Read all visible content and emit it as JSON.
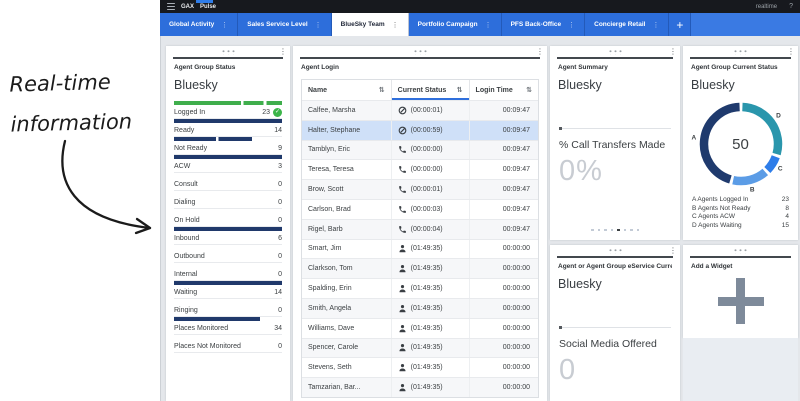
{
  "annotation": {
    "line1": "Real-time",
    "line2": "information"
  },
  "topbar": {
    "app": "GAX",
    "product": "Pulse",
    "mode": "realtime",
    "help": "?"
  },
  "tabbar": {
    "menu_icon": "⋮",
    "add_tab": "+",
    "tabs": [
      {
        "label": "Global Activity",
        "active": false
      },
      {
        "label": "Sales Service Level",
        "active": false
      },
      {
        "label": "BlueSky Team",
        "active": true
      },
      {
        "label": "Portfolio Campaign",
        "active": false
      },
      {
        "label": "PFS Back-Office",
        "active": false
      },
      {
        "label": "Concierge Retail",
        "active": false
      }
    ]
  },
  "agent_group_status": {
    "header": "Agent Group Status",
    "title": "Bluesky",
    "rows": [
      {
        "label": "Logged In",
        "value": "23",
        "bar": 100,
        "color": "green",
        "segmented": true,
        "check": true
      },
      {
        "label": "Ready",
        "value": "14",
        "bar": 100,
        "color": "navy",
        "segmented": false
      },
      {
        "label": "Not Ready",
        "value": "9",
        "bar": 72,
        "color": "navy",
        "segmented": true
      },
      {
        "label": "ACW",
        "value": "3",
        "bar": 100,
        "color": "navy",
        "segmented": false
      },
      {
        "label": "Consult",
        "value": "0",
        "bar": 0
      },
      {
        "label": "Dialing",
        "value": "0",
        "bar": 0
      },
      {
        "label": "On Hold",
        "value": "0",
        "bar": 0
      },
      {
        "label": "Inbound",
        "value": "6",
        "bar": 100,
        "color": "navy",
        "segmented": false
      },
      {
        "label": "Outbound",
        "value": "0",
        "bar": 0
      },
      {
        "label": "Internal",
        "value": "0",
        "bar": 0
      },
      {
        "label": "Waiting",
        "value": "14",
        "bar": 100,
        "color": "navy",
        "segmented": false
      },
      {
        "label": "Ringing",
        "value": "0",
        "bar": 0
      },
      {
        "label": "Places Monitored",
        "value": "34",
        "bar": 80,
        "color": "navy",
        "segmented": false
      },
      {
        "label": "Places Not Monitored",
        "value": "0",
        "bar": 0
      }
    ]
  },
  "agent_login": {
    "header": "Agent Login",
    "sort_icon": "⇅",
    "columns": [
      {
        "label": "Name",
        "sorted": false
      },
      {
        "label": "Current Status",
        "sorted": true
      },
      {
        "label": "Login Time",
        "sorted": false
      }
    ],
    "rows": [
      {
        "name": "Calfee, Marsha",
        "status_icon": "ready",
        "status": "(00:00:01)",
        "login_time": "00:09:47",
        "highlight": false
      },
      {
        "name": "Halter, Stephane",
        "status_icon": "ready",
        "status": "(00:00:59)",
        "login_time": "00:09:47",
        "highlight": true
      },
      {
        "name": "Tamblyn, Eric",
        "status_icon": "call",
        "status": "(00:00:00)",
        "login_time": "00:09:47",
        "highlight": false
      },
      {
        "name": "Teresa, Teresa",
        "status_icon": "call",
        "status": "(00:00:00)",
        "login_time": "00:09:47",
        "highlight": false
      },
      {
        "name": "Brow, Scott",
        "status_icon": "call",
        "status": "(00:00:01)",
        "login_time": "00:09:47",
        "highlight": false
      },
      {
        "name": "Carlson, Brad",
        "status_icon": "call",
        "status": "(00:00:03)",
        "login_time": "00:09:47",
        "highlight": false
      },
      {
        "name": "Rigel, Barb",
        "status_icon": "call",
        "status": "(00:00:04)",
        "login_time": "00:09:47",
        "highlight": false
      },
      {
        "name": "Smart, Jim",
        "status_icon": "logout",
        "status": "(01:49:35)",
        "login_time": "00:00:00",
        "highlight": false
      },
      {
        "name": "Clarkson, Tom",
        "status_icon": "logout",
        "status": "(01:49:35)",
        "login_time": "00:00:00",
        "highlight": false
      },
      {
        "name": "Spalding, Erin",
        "status_icon": "logout",
        "status": "(01:49:35)",
        "login_time": "00:00:00",
        "highlight": false
      },
      {
        "name": "Smith, Angela",
        "status_icon": "logout",
        "status": "(01:49:35)",
        "login_time": "00:00:00",
        "highlight": false
      },
      {
        "name": "Williams, Dave",
        "status_icon": "logout",
        "status": "(01:49:35)",
        "login_time": "00:00:00",
        "highlight": false
      },
      {
        "name": "Spencer, Carole",
        "status_icon": "logout",
        "status": "(01:49:35)",
        "login_time": "00:00:00",
        "highlight": false
      },
      {
        "name": "Stevens, Seth",
        "status_icon": "logout",
        "status": "(01:49:35)",
        "login_time": "00:00:00",
        "highlight": false
      },
      {
        "name": "Tamzarian, Bar...",
        "status_icon": "logout",
        "status": "(01:49:35)",
        "login_time": "00:00:00",
        "highlight": false
      }
    ]
  },
  "agent_summary": {
    "header": "Agent Summary",
    "title": "Bluesky",
    "metric_label": "% Call Transfers Made",
    "metric_value": "0%",
    "page_dots": {
      "count": 8,
      "active": 5
    }
  },
  "agent_group_current_status": {
    "header": "Agent Group Current Status",
    "title": "Bluesky",
    "chart_data": {
      "type": "donut",
      "center_value": "50",
      "total": 50,
      "draw_order": [
        "D",
        "C",
        "B",
        "A"
      ],
      "segments": [
        {
          "key": "A",
          "label": "Agents Logged In",
          "value": 23,
          "color": "#1f3a6d"
        },
        {
          "key": "B",
          "label": "Agents Not Ready",
          "value": 8,
          "color": "#5b9ce6"
        },
        {
          "key": "C",
          "label": "Agents ACW",
          "value": 4,
          "color": "#2e7de9"
        },
        {
          "key": "D",
          "label": "Agents Waiting",
          "value": 15,
          "color": "#2a96ac"
        }
      ]
    }
  },
  "eservice_widget": {
    "header": "Agent or Agent Group eService Current...",
    "title": "Bluesky",
    "metric_label": "Social Media Offered",
    "metric_value": "0"
  },
  "add_widget": {
    "header": "Add a Widget"
  },
  "colors": {
    "tab_blue": "#2d6edb",
    "navy_bar": "#20396b",
    "green_bar": "#3fae4c",
    "highlight_row": "#cfe0f8",
    "sorted_underline": "#2f6fdc"
  }
}
